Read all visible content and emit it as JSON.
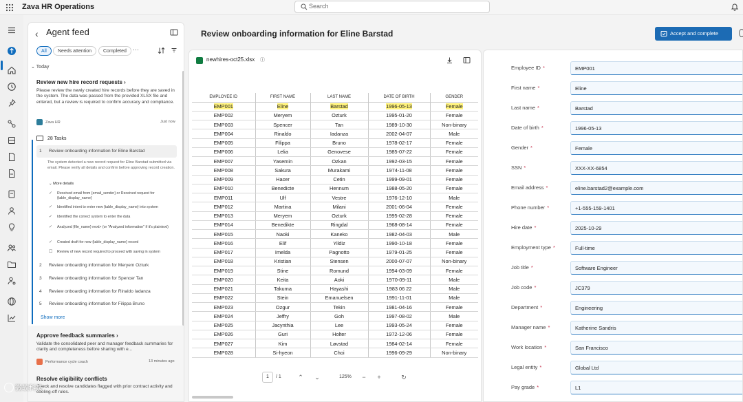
{
  "app": {
    "title": "Zava HR Operations"
  },
  "search": {
    "placeholder": "Search"
  },
  "feed": {
    "title": "Agent feed",
    "chips": {
      "all": "All",
      "needs": "Needs attention",
      "completed": "Completed",
      "more": "···"
    },
    "section": "Today",
    "card1": {
      "title": "Review new hire record requests",
      "body": "Please review the newly created hire records before they are saved in the system. The data was passed from the provided XLSX file and entered, but a review is required to confirm accuracy and compliance.",
      "source": "Zava HR",
      "time": "Just now"
    },
    "tasks_head": "28 Tasks",
    "task1": {
      "n": "1",
      "label": "Review onboarding information for Eline Barstad"
    },
    "task1_desc": "The system detected a new record request for Eline Barstad submitted via email. Please verify all details and confirm before approving record creation.",
    "more_details": "More details",
    "steps": [
      "Received email from {email_sender} or Received request for {table_display_name}",
      "Identified intent to enter new {table_display_name} into system",
      "Identified the correct system to enter the data",
      "Analyzed {file_name} next> (or \"Analyzed information\" if it's plaintext)",
      "Created draft for new {table_display_name} record",
      "Review of new record required to proceed with saving in system"
    ],
    "tasks": [
      {
        "n": "2",
        "label": "Review onboarding information for Meryem Ozturk"
      },
      {
        "n": "3",
        "label": "Review onboarding information for Spencer Tan"
      },
      {
        "n": "4",
        "label": "Review onboarding information for Rinaldo Iadanza"
      },
      {
        "n": "5",
        "label": "Review onboarding information for Filippa Bruno"
      }
    ],
    "show_more": "Show more",
    "card2": {
      "title": "Approve feedback summaries",
      "body": "Validate the consolidated peer and manager feedback summaries for clarity and completeness before sharing with e...",
      "source": "Performance cycle coach",
      "time": "13 minutes ago"
    },
    "card3": {
      "title": "Resolve eligibility conflicts",
      "body": "Check and resolve candidates flagged with prior contract activity and cooling-off rules."
    }
  },
  "main": {
    "page_title": "Review onboarding information for Eline Barstad",
    "accept_label": "Accept and complete"
  },
  "doc": {
    "file_name": "newhires-oct25.xlsx",
    "info_icon": "ⓘ",
    "headers": [
      "EMPLOYEE ID",
      "FIRST NAME",
      "LAST NAME",
      "DATE OF BIRTH",
      "GENDER"
    ],
    "rows": [
      [
        "EMP001",
        "Eline",
        "Barstad",
        "1996-05-13",
        "Female"
      ],
      [
        "EMP002",
        "Meryem",
        "Ozturk",
        "1995-01-20",
        "Female"
      ],
      [
        "EMP003",
        "Spencer",
        "Tan",
        "1989-10-30",
        "Non-binary"
      ],
      [
        "EMP004",
        "Rinaldo",
        "Iadanza",
        "2002-04-07",
        "Male"
      ],
      [
        "EMP005",
        "Filippa",
        "Bruno",
        "1978-02-17",
        "Female"
      ],
      [
        "EMP006",
        "Lelia",
        "Genovese",
        "1985-07-22",
        "Female"
      ],
      [
        "EMP007",
        "Yasemin",
        "Ozkan",
        "1992-03-15",
        "Female"
      ],
      [
        "EMP008",
        "Sakura",
        "Murakami",
        "1974-11-08",
        "Female"
      ],
      [
        "EMP009",
        "Hacer",
        "Cetin",
        "1999-09-01",
        "Female"
      ],
      [
        "EMP010",
        "Benedicte",
        "Hennum",
        "1988-05-20",
        "Female"
      ],
      [
        "EMP011",
        "Ulf",
        "Vestre",
        "1976-12-10",
        "Male"
      ],
      [
        "EMP012",
        "Martina",
        "Milani",
        "2001-06-04",
        "Female"
      ],
      [
        "EMP013",
        "Meryem",
        "Ozturk",
        "1995-02-28",
        "Female"
      ],
      [
        "EMP014",
        "Benedikte",
        "Ringdal",
        "1968-08-14",
        "Female"
      ],
      [
        "EMP015",
        "Naoki",
        "Kaneko",
        "1982-04-03",
        "Male"
      ],
      [
        "EMP016",
        "Elif",
        "Yildiz",
        "1990-10-18",
        "Female"
      ],
      [
        "EMP017",
        "Imelda",
        "Pagnotto",
        "1979-01-25",
        "Female"
      ],
      [
        "EMP018",
        "Kristian",
        "Stensen",
        "2000-07-07",
        "Non-binary"
      ],
      [
        "EMP019",
        "Stine",
        "Romund",
        "1994-03-09",
        "Female"
      ],
      [
        "EMP020",
        "Keita",
        "Aoki",
        "1970-09-11",
        "Male"
      ],
      [
        "EMP021",
        "Takuma",
        "Hayashi",
        "1983 06 22",
        "Male"
      ],
      [
        "EMP022",
        "Stein",
        "Emanuelsen",
        "1991-11-01",
        "Male"
      ],
      [
        "EMP023",
        "Ozgur",
        "Tekin",
        "1981-04-16",
        "Female"
      ],
      [
        "EMP024",
        "Jeffry",
        "Goh",
        "1997-08-02",
        "Male"
      ],
      [
        "EMP025",
        "Jacynthia",
        "Lee",
        "1993-05-24",
        "Female"
      ],
      [
        "EMP026",
        "Guri",
        "Holter",
        "1972-12-06",
        "Female"
      ],
      [
        "EMP027",
        "Kim",
        "Løvstad",
        "1984-02-14",
        "Female"
      ],
      [
        "EMP028",
        "Si-hyeon",
        "Choi",
        "1996-09-29",
        "Non-binary"
      ]
    ],
    "page": "1",
    "page_of": "/ 1",
    "zoom": "125%"
  },
  "form": {
    "fields": [
      {
        "label": "Employee ID",
        "value": "EMP001"
      },
      {
        "label": "First name",
        "value": "Eline"
      },
      {
        "label": "Last name",
        "value": "Barstad"
      },
      {
        "label": "Date of birth",
        "value": "1996-05-13"
      },
      {
        "label": "Gender",
        "value": "Female"
      },
      {
        "label": "SSN",
        "value": "XXX-XX-6854"
      },
      {
        "label": "Email address",
        "value": "eline.barstad2@example.com"
      },
      {
        "label": "Phone number",
        "value": "+1-555-159-1401"
      },
      {
        "label": "Hire date",
        "value": "2025-10-29"
      },
      {
        "label": "Employment type",
        "value": "Full-time"
      },
      {
        "label": "Job title",
        "value": "Software Engineer"
      },
      {
        "label": "Job code",
        "value": "JC379"
      },
      {
        "label": "Department",
        "value": "Engineering"
      },
      {
        "label": "Manager name",
        "value": "Katherine Sandris"
      },
      {
        "label": "Work location",
        "value": "San Francisco"
      },
      {
        "label": "Legal entity",
        "value": "Global Ltd"
      },
      {
        "label": "Pay grade",
        "value": "L1"
      }
    ],
    "required_mark": "*"
  },
  "watermark": "微软科技",
  "colors": {
    "accent": "#0f6cbd",
    "accept_button": "#1c6bb4",
    "highlight": "#fff27a"
  },
  "icons": [
    "apps-icon",
    "search-icon",
    "bell-icon",
    "home-icon",
    "clock-icon",
    "pin-icon",
    "people-icon",
    "document-icon",
    "chevron-left-icon",
    "collapse-panel-icon",
    "sort-icon",
    "filter-icon",
    "download-icon",
    "split-view-icon",
    "accept-icon"
  ]
}
